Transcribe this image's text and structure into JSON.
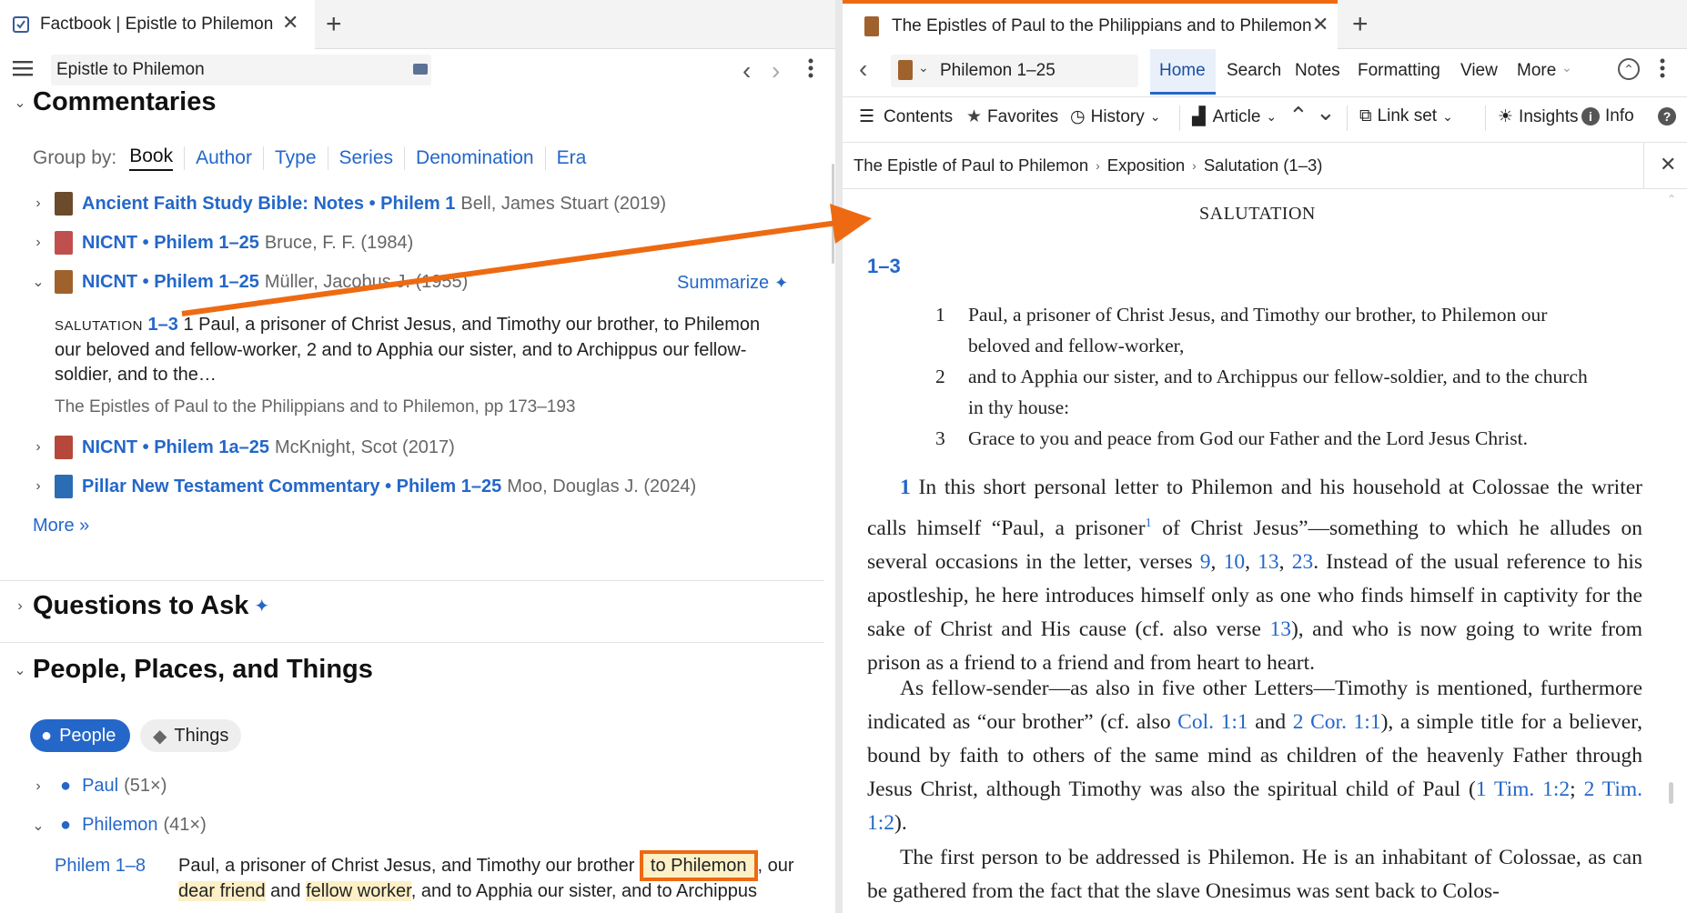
{
  "left": {
    "tab_title": "Factbook | Epistle to Philemon",
    "search_value": "Epistle to Philemon",
    "commentaries": {
      "heading": "Commentaries",
      "group_by_label": "Group by:",
      "group_options": [
        "Book",
        "Author",
        "Type",
        "Series",
        "Denomination",
        "Era"
      ],
      "items": [
        {
          "title": "Ancient Faith Study Bible: Notes • Philem 1",
          "author": "Bell, James Stuart (2019)",
          "color": "#6b4b2b"
        },
        {
          "title": "NICNT • Philem 1–25",
          "author": "Bruce, F. F. (1984)",
          "color": "#c0504d"
        },
        {
          "title": "NICNT • Philem 1–25",
          "author": "Müller, Jacobus J. (1955)",
          "color": "#a0622d"
        },
        {
          "title": "NICNT • Philem 1a–25",
          "author": "McKnight, Scot (2017)",
          "color": "#b5483b"
        },
        {
          "title": "Pillar New Testament Commentary • Philem 1–25",
          "author": "Moo, Douglas J. (2024)",
          "color": "#2a6db5"
        }
      ],
      "summarize": "Summarize",
      "excerpt_label": "SALUTATION",
      "excerpt_ref": "1–3",
      "excerpt_line1": " 1  Paul, a prisoner of Christ Jesus, and Timothy our brother, to Philemon",
      "excerpt_line2": "our beloved and fellow-worker, 2  and to Apphia our sister, and to Archippus our fellow-",
      "excerpt_line3": "soldier, and to the…",
      "excerpt_source": "The Epistles of Paul to the Philippians and to Philemon, pp 173–193",
      "more": "More »"
    },
    "questions": {
      "heading": "Questions to Ask"
    },
    "ppt": {
      "heading": "People, Places, and Things",
      "pill_people": "People",
      "pill_things": "Things",
      "people": [
        {
          "name": "Paul",
          "count": "(51×)"
        },
        {
          "name": "Philemon",
          "count": "(41×)"
        }
      ],
      "ref": "Philem 1–8",
      "line1a": "Paul, a prisoner of Christ Jesus, and Timothy our brother ",
      "line1b": "to Philemon",
      "line1c": ", our",
      "line2a": "dear friend",
      "line2b": " and ",
      "line2c": "fellow worker",
      "line2d": ", and to Apphia our sister, and to Archippus"
    }
  },
  "right": {
    "tab_title": "The Epistles of Paul to the Philippians and to Philemon",
    "reference": "Philemon 1–25",
    "menu": [
      "Home",
      "Search",
      "Notes",
      "Formatting",
      "View",
      "More"
    ],
    "toolbar": {
      "contents": "Contents",
      "favorites": "Favorites",
      "history": "History",
      "article": "Article",
      "linkset": "Link set",
      "insights": "Insights",
      "info": "Info"
    },
    "breadcrumb": [
      "The Epistle of Paul to Philemon",
      "Exposition",
      "Salutation (1–3)"
    ],
    "section_title": "SALUTATION",
    "range": "1–3",
    "verses": [
      {
        "n": "1",
        "l1": "Paul, a prisoner of Christ Jesus, and Timothy our brother, to Philemon our",
        "l2": "beloved and fellow-worker,"
      },
      {
        "n": "2",
        "l1": "and to Apphia our sister, and to Archippus our fellow-soldier, and to the church",
        "l2": "in thy house:"
      },
      {
        "n": "3",
        "l1": "Grace to you and peace from God our Father and the Lord Jesus Christ.",
        "l2": ""
      }
    ],
    "p1": {
      "num": "1",
      "a": " In this short personal letter to Philemon and his household at Colossae the writer calls himself “Paul, a prisoner",
      "fn": "1",
      "b": " of Christ Jesus”—something to which he alludes on several occasions in the letter, verses ",
      "v9": "9",
      "v10": "10",
      "v13": "13",
      "v23": "23",
      "c": ". Instead of the usual reference to his apostleship, he here introduces himself only as one who finds himself in captivity for the sake of Christ and His cause (cf. also verse ",
      "v13b": "13",
      "d": "), and who is now going to write from prison as a friend to a friend and from heart to heart."
    },
    "p2": {
      "a": "As fellow-sender—as also in five other Letters—Timothy is mentioned, furthermore indicated as “our brother” (cf. also ",
      "col": "Col. 1:1",
      "b": " and ",
      "cor": "2 Cor. 1:1",
      "c": "), a simple title for a believer, bound by faith to others of the same mind as children of the heavenly Father through Jesus Christ, although Timothy was also the spiritual child of Paul (",
      "tim1": "1 Tim. 1:2",
      "sep": "; ",
      "tim2": "2 Tim. 1:2",
      "d": ")."
    },
    "p3": "The first person to be addressed is Philemon. He is an inhabitant of Colossae, as can be gathered from the fact that the slave Onesimus was sent back to Colos-"
  },
  "colors": {
    "accent": "#2467c9",
    "annotation": "#ee6a12",
    "highlight": "#fdf0c6"
  }
}
